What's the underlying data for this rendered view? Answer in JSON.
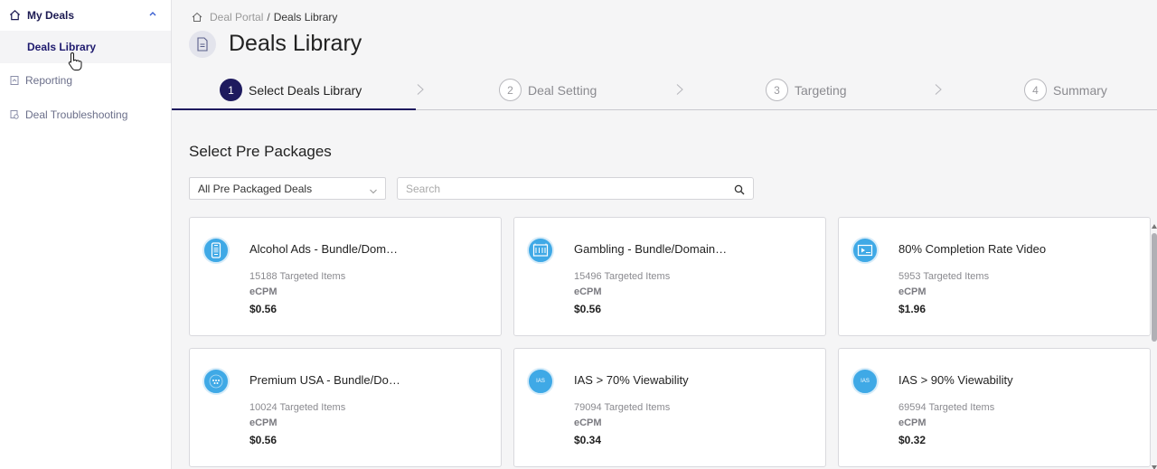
{
  "sidebar": {
    "group_label": "My Deals",
    "sub_item": "Deals Library",
    "items": [
      {
        "label": "Reporting"
      },
      {
        "label": "Deal Troubleshooting"
      }
    ]
  },
  "breadcrumb": {
    "root": "Deal Portal",
    "separator": "/",
    "current": "Deals Library"
  },
  "page_title": "Deals Library",
  "steps": [
    {
      "num": "1",
      "label": "Select Deals Library",
      "active": true
    },
    {
      "num": "2",
      "label": "Deal Setting",
      "active": false
    },
    {
      "num": "3",
      "label": "Targeting",
      "active": false
    },
    {
      "num": "4",
      "label": "Summary",
      "active": false
    }
  ],
  "section_title": "Select Pre Packages",
  "filter": {
    "selected": "All Pre Packaged Deals",
    "search_placeholder": "Search"
  },
  "cards": [
    {
      "name": "Alcohol Ads - Bundle/Dom…",
      "items": "15188 Targeted Items",
      "label": "eCPM",
      "price": "$0.56",
      "icon": "mobile-icon"
    },
    {
      "name": "Gambling - Bundle/Domain…",
      "items": "15496 Targeted Items",
      "label": "eCPM",
      "price": "$0.56",
      "icon": "slot-machine-icon"
    },
    {
      "name": "80% Completion Rate Video",
      "items": "5953 Targeted Items",
      "label": "eCPM",
      "price": "$1.96",
      "icon": "video-icon"
    },
    {
      "name": "Premium USA - Bundle/Do…",
      "items": "10024 Targeted Items",
      "label": "eCPM",
      "price": "$0.56",
      "icon": "premium-badge-icon"
    },
    {
      "name": "IAS > 70% Viewability",
      "items": "79094 Targeted Items",
      "label": "eCPM",
      "price": "$0.34",
      "icon": "ias-logo-icon",
      "icon_text": "IAS"
    },
    {
      "name": "IAS > 90% Viewability",
      "items": "69594 Targeted Items",
      "label": "eCPM",
      "price": "$0.32",
      "icon": "ias-logo-icon",
      "icon_text": "IAS"
    }
  ],
  "colors": {
    "brand": "#1e1a5e",
    "card_icon": "#3fa9e6",
    "background": "#f5f5f6"
  }
}
